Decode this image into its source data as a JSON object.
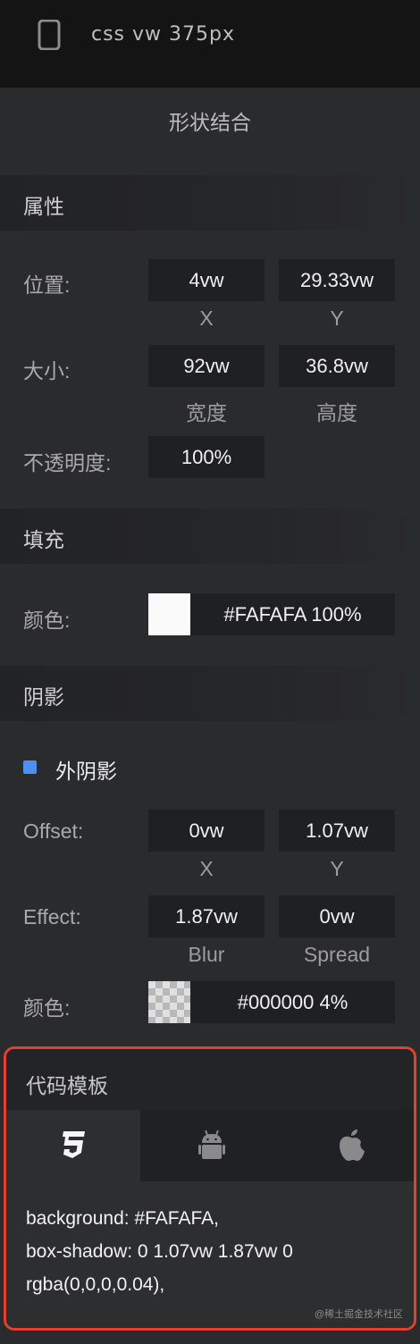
{
  "topbar": {
    "title": "css vw 375px",
    "device_icon": "phone-icon"
  },
  "panel_title": "形状结合",
  "properties": {
    "header": "属性",
    "position": {
      "label": "位置:",
      "x": "4vw",
      "y": "29.33vw",
      "x_caption": "X",
      "y_caption": "Y"
    },
    "size": {
      "label": "大小:",
      "width": "92vw",
      "height": "36.8vw",
      "width_caption": "宽度",
      "height_caption": "高度"
    },
    "opacity": {
      "label": "不透明度:",
      "value": "100%"
    }
  },
  "fill": {
    "header": "填充",
    "color_label": "颜色:",
    "color_value": "#FAFAFA 100%",
    "swatch_color": "#FAFAFA"
  },
  "shadow": {
    "header": "阴影",
    "type_label": "外阴影",
    "offset": {
      "label": "Offset:",
      "x": "0vw",
      "y": "1.07vw",
      "x_caption": "X",
      "y_caption": "Y"
    },
    "effect": {
      "label": "Effect:",
      "blur": "1.87vw",
      "spread": "0vw",
      "blur_caption": "Blur",
      "spread_caption": "Spread"
    },
    "color_label": "颜色:",
    "color_value": "#000000 4%"
  },
  "code": {
    "header": "代码模板",
    "tabs": [
      {
        "name": "css3-icon",
        "active": true
      },
      {
        "name": "android-icon",
        "active": false
      },
      {
        "name": "apple-icon",
        "active": false
      }
    ],
    "lines": [
      "background: #FAFAFA,",
      "box-shadow: 0 1.07vw 1.87vw 0",
      "rgba(0,0,0,0.04),"
    ],
    "watermark": "@稀土掘金技术社区"
  },
  "colors": {
    "accent_blue": "#4F8FF0",
    "highlight_red": "#E5402E"
  }
}
